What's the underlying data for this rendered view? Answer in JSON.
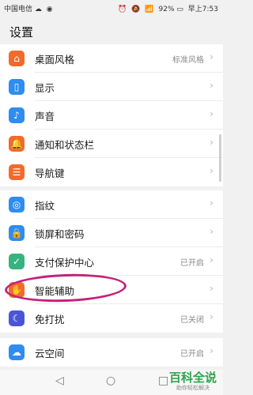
{
  "status_bar": {
    "carrier": "中国电信",
    "battery": "92%",
    "time": "早上7:53"
  },
  "title": "设置",
  "groups": [
    {
      "items": [
        {
          "label": "桌面风格",
          "value": "标准风格",
          "icon": "desktop-style-icon",
          "color": "#f26b2a"
        },
        {
          "label": "显示",
          "value": "",
          "icon": "display-icon",
          "color": "#2f8cf0"
        },
        {
          "label": "声音",
          "value": "",
          "icon": "sound-icon",
          "color": "#2f8cf0"
        },
        {
          "label": "通知和状态栏",
          "value": "",
          "icon": "notification-icon",
          "color": "#f26b2a"
        },
        {
          "label": "导航键",
          "value": "",
          "icon": "navigation-key-icon",
          "color": "#f26b2a"
        }
      ]
    },
    {
      "items": [
        {
          "label": "指纹",
          "value": "",
          "icon": "fingerprint-icon",
          "color": "#2f8cf0"
        },
        {
          "label": "锁屏和密码",
          "value": "",
          "icon": "lock-icon",
          "color": "#2f8cf0"
        },
        {
          "label": "支付保护中心",
          "value": "已开启",
          "icon": "shield-check-icon",
          "color": "#36b37e"
        },
        {
          "label": "智能辅助",
          "value": "",
          "icon": "hand-icon",
          "color": "#f26b2a"
        },
        {
          "label": "免打扰",
          "value": "已关闭",
          "icon": "moon-icon",
          "color": "#4a55d6"
        }
      ]
    },
    {
      "items": [
        {
          "label": "云空间",
          "value": "已开启",
          "icon": "cloud-icon",
          "color": "#2f8cf0"
        }
      ]
    }
  ],
  "watermark": {
    "line1": "百科全说",
    "line2": "助你轻松解决"
  }
}
